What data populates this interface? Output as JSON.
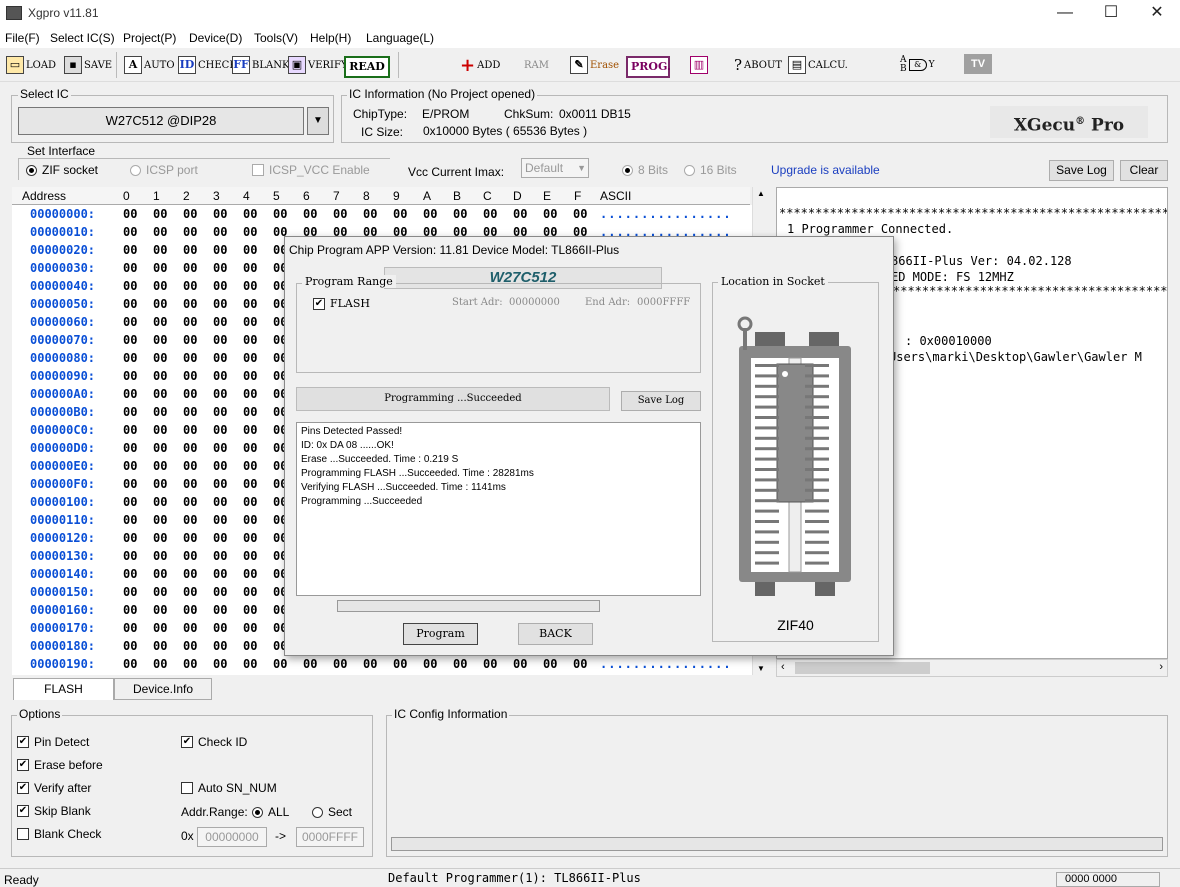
{
  "window": {
    "title": "Xgpro v11.81",
    "min": "—",
    "max": "☐",
    "close": "✕"
  },
  "menu": [
    "File(F)",
    "Select IC(S)",
    "Project(P)",
    "Device(D)",
    "Tools(V)",
    "Help(H)",
    "Language(L)"
  ],
  "toolbar": {
    "load": "LOAD",
    "save": "SAVE",
    "auto": "AUTO",
    "check": "CHECK",
    "blank": "BLANK",
    "verify": "VERIFY",
    "read": "READ",
    "add": "ADD",
    "ram": "RAM",
    "erase": "Erase",
    "prog": "PROG.",
    "about": "ABOUT",
    "calcu": "CALCU.",
    "gate_a": "A",
    "gate_b": "B",
    "gate_y": "Y",
    "tv": "TV"
  },
  "select_ic": {
    "label": "Select IC",
    "value": "W27C512 @DIP28"
  },
  "ic_info": {
    "label": "IC Information (No Project opened)",
    "chip_type_label": "ChipType:",
    "chip_type": "E/PROM",
    "chksum_label": "ChkSum:",
    "chksum": "0x0011 DB15",
    "ic_size_label": "IC Size:",
    "ic_size": "0x10000 Bytes ( 65536 Bytes )",
    "logo": "XGecu",
    "logo_reg": "®",
    "logo_pro": "Pro"
  },
  "interface": {
    "label": "Set Interface",
    "zif": "ZIF socket",
    "icsp": "ICSP port",
    "icsp_vcc": "ICSP_VCC Enable",
    "vcc_label": "Vcc Current Imax:",
    "vcc_value": "Default",
    "bits8": "8 Bits",
    "bits16": "16 Bits",
    "upgrade": "Upgrade is available",
    "save_log": "Save Log",
    "clear": "Clear"
  },
  "hex": {
    "headers": {
      "address": "Address",
      "cols": [
        "0",
        "1",
        "2",
        "3",
        "4",
        "5",
        "6",
        "7",
        "8",
        "9",
        "A",
        "B",
        "C",
        "D",
        "E",
        "F"
      ],
      "ascii": "ASCII"
    },
    "rows": [
      {
        "addr": "00000000:",
        "bytes": [
          "00",
          "00",
          "00",
          "00",
          "00",
          "00",
          "00",
          "00",
          "00",
          "00",
          "00",
          "00",
          "00",
          "00",
          "00",
          "00"
        ],
        "ascii": "................"
      },
      {
        "addr": "00000010:",
        "bytes": [
          "00",
          "00",
          "00",
          "00",
          "00",
          "00",
          "00",
          "00",
          "00",
          "00",
          "00",
          "00",
          "00",
          "00",
          "00",
          "00"
        ],
        "ascii": "................"
      },
      {
        "addr": "00000020:",
        "bytes": [
          "00",
          "00",
          "00",
          "00",
          "00",
          "00",
          "00",
          "00",
          "00",
          "00",
          "00",
          "00",
          "00",
          "00",
          "00",
          "00"
        ],
        "ascii": "................"
      },
      {
        "addr": "00000030:",
        "bytes": [
          "00",
          "00",
          "00",
          "00",
          "00",
          "00",
          "00",
          "00",
          "00",
          "00",
          "00",
          "00",
          "00",
          "00",
          "00",
          "00"
        ],
        "ascii": "................"
      },
      {
        "addr": "00000040:",
        "bytes": [
          "00",
          "00",
          "00",
          "00",
          "00",
          "00",
          "00",
          "00",
          "00",
          "00",
          "00",
          "00",
          "00",
          "00",
          "00",
          "00"
        ],
        "ascii": "................"
      },
      {
        "addr": "00000050:",
        "bytes": [
          "00",
          "00",
          "00",
          "00",
          "00",
          "00",
          "00",
          "00",
          "00",
          "00",
          "00",
          "00",
          "00",
          "00",
          "00",
          "00"
        ],
        "ascii": "................"
      },
      {
        "addr": "00000060:",
        "bytes": [
          "00",
          "00",
          "00",
          "00",
          "00",
          "00",
          "00",
          "00",
          "00",
          "00",
          "00",
          "00",
          "00",
          "00",
          "00",
          "00"
        ],
        "ascii": "................"
      },
      {
        "addr": "00000070:",
        "bytes": [
          "00",
          "00",
          "00",
          "00",
          "00",
          "00",
          "00",
          "00",
          "00",
          "00",
          "00",
          "00",
          "00",
          "00",
          "00",
          "00"
        ],
        "ascii": "................"
      },
      {
        "addr": "00000080:",
        "bytes": [
          "00",
          "00",
          "00",
          "00",
          "00",
          "00",
          "00",
          "00",
          "00",
          "00",
          "00",
          "00",
          "00",
          "00",
          "00",
          "00"
        ],
        "ascii": "................"
      },
      {
        "addr": "00000090:",
        "bytes": [
          "00",
          "00",
          "00",
          "00",
          "00",
          "00",
          "00",
          "00",
          "00",
          "00",
          "00",
          "00",
          "00",
          "00",
          "00",
          "00"
        ],
        "ascii": "................"
      },
      {
        "addr": "000000A0:",
        "bytes": [
          "00",
          "00",
          "00",
          "00",
          "00",
          "00",
          "00",
          "00",
          "00",
          "00",
          "00",
          "00",
          "00",
          "00",
          "00",
          "00"
        ],
        "ascii": "................"
      },
      {
        "addr": "000000B0:",
        "bytes": [
          "00",
          "00",
          "00",
          "00",
          "00",
          "00",
          "00",
          "00",
          "00",
          "00",
          "00",
          "00",
          "00",
          "00",
          "00",
          "00"
        ],
        "ascii": "................"
      },
      {
        "addr": "000000C0:",
        "bytes": [
          "00",
          "00",
          "00",
          "00",
          "00",
          "00",
          "00",
          "00",
          "00",
          "00",
          "00",
          "00",
          "00",
          "00",
          "00",
          "00"
        ],
        "ascii": "................"
      },
      {
        "addr": "000000D0:",
        "bytes": [
          "00",
          "00",
          "00",
          "00",
          "00",
          "00",
          "00",
          "00",
          "00",
          "00",
          "00",
          "00",
          "00",
          "00",
          "00",
          "00"
        ],
        "ascii": "................"
      },
      {
        "addr": "000000E0:",
        "bytes": [
          "00",
          "00",
          "00",
          "00",
          "00",
          "00",
          "00",
          "00",
          "00",
          "00",
          "00",
          "00",
          "00",
          "00",
          "00",
          "00"
        ],
        "ascii": "................"
      },
      {
        "addr": "000000F0:",
        "bytes": [
          "00",
          "00",
          "00",
          "00",
          "00",
          "00",
          "00",
          "00",
          "00",
          "00",
          "00",
          "00",
          "00",
          "00",
          "00",
          "00"
        ],
        "ascii": "................"
      },
      {
        "addr": "00000100:",
        "bytes": [
          "00",
          "00",
          "00",
          "00",
          "00",
          "00",
          "00",
          "00",
          "00",
          "00",
          "00",
          "00",
          "00",
          "00",
          "00",
          "00"
        ],
        "ascii": "................"
      },
      {
        "addr": "00000110:",
        "bytes": [
          "00",
          "00",
          "00",
          "00",
          "00",
          "00",
          "00",
          "00",
          "00",
          "00",
          "00",
          "00",
          "00",
          "00",
          "00",
          "00"
        ],
        "ascii": "................"
      },
      {
        "addr": "00000120:",
        "bytes": [
          "00",
          "00",
          "00",
          "00",
          "00",
          "00",
          "00",
          "00",
          "00",
          "00",
          "00",
          "00",
          "00",
          "00",
          "00",
          "00"
        ],
        "ascii": "................"
      },
      {
        "addr": "00000130:",
        "bytes": [
          "00",
          "00",
          "00",
          "00",
          "00",
          "00",
          "00",
          "00",
          "00",
          "00",
          "00",
          "00",
          "00",
          "00",
          "00",
          "00"
        ],
        "ascii": "................"
      },
      {
        "addr": "00000140:",
        "bytes": [
          "00",
          "00",
          "00",
          "00",
          "00",
          "00",
          "00",
          "00",
          "00",
          "00",
          "00",
          "00",
          "00",
          "00",
          "00",
          "00"
        ],
        "ascii": "................"
      },
      {
        "addr": "00000150:",
        "bytes": [
          "00",
          "00",
          "00",
          "00",
          "00",
          "00",
          "00",
          "00",
          "00",
          "00",
          "00",
          "00",
          "00",
          "00",
          "00",
          "00"
        ],
        "ascii": "................"
      },
      {
        "addr": "00000160:",
        "bytes": [
          "00",
          "00",
          "00",
          "00",
          "00",
          "00",
          "00",
          "00",
          "00",
          "00",
          "00",
          "00",
          "00",
          "00",
          "00",
          "00"
        ],
        "ascii": "................"
      },
      {
        "addr": "00000170:",
        "bytes": [
          "00",
          "00",
          "00",
          "00",
          "00",
          "00",
          "00",
          "00",
          "00",
          "00",
          "00",
          "00",
          "00",
          "00",
          "00",
          "00"
        ],
        "ascii": "................"
      },
      {
        "addr": "00000180:",
        "bytes": [
          "00",
          "00",
          "00",
          "00",
          "00",
          "00",
          "00",
          "00",
          "00",
          "00",
          "00",
          "00",
          "00",
          "00",
          "00",
          "00"
        ],
        "ascii": "................"
      },
      {
        "addr": "00000190:",
        "bytes": [
          "00",
          "00",
          "00",
          "00",
          "00",
          "00",
          "00",
          "00",
          "00",
          "00",
          "00",
          "00",
          "00",
          "00",
          "00",
          "00"
        ],
        "ascii": "................"
      }
    ]
  },
  "log": [
    "******************************************************",
    "1 Programmer Connected.",
    "866II-Plus Ver: 04.02.128",
    "ED MODE: FS 12MHZ",
    "******************************************************",
    ": 0x00010000",
    "Users\\marki\\Desktop\\Gawler\\Gawler M"
  ],
  "dialog": {
    "title": "Chip Program    APP Version: 11.81 Device Model: TL866II-Plus",
    "chip": "W27C512",
    "program_range": "Program Range",
    "flash": "FLASH",
    "start_label": "Start Adr:",
    "start": "00000000",
    "end_label": "End Adr:",
    "end": "0000FFFF",
    "status": "Programming  ...Succeeded",
    "save_log": "Save Log",
    "messages": [
      "Pins Detected Passed!",
      "ID: 0x DA 08 ......OK!",
      "Erase  ...Succeeded. Time : 0.219 S",
      "Programming FLASH ...Succeeded. Time : 28281ms",
      "Verifying FLASH ...Succeeded. Time : 1141ms",
      "Programming  ...Succeeded"
    ],
    "program_btn": "Program",
    "back_btn": "BACK",
    "location_label": "Location in Socket",
    "zif": "ZIF40"
  },
  "tabs": [
    "FLASH",
    "Device.Info"
  ],
  "options": {
    "label": "Options",
    "pin_detect": "Pin Detect",
    "erase_before": "Erase before",
    "verify_after": "Verify after",
    "skip_blank": "Skip Blank",
    "blank_check": "Blank Check",
    "check_id": "Check ID",
    "auto_sn": "Auto SN_NUM",
    "addr_range": "Addr.Range:",
    "all": "ALL",
    "sect": "Sect",
    "ox": "0x",
    "from": "00000000",
    "arrow": "->",
    "to": "0000FFFF"
  },
  "ic_config": {
    "label": "IC Config Information"
  },
  "status": {
    "left": "Ready",
    "center": "Default Programmer(1): TL866II-Plus",
    "right": "0000 0000"
  },
  "colors": {
    "accent_blue": "#0a4fd6",
    "chip_teal": "#1f5f6b",
    "read_border": "#1a6e1a"
  }
}
